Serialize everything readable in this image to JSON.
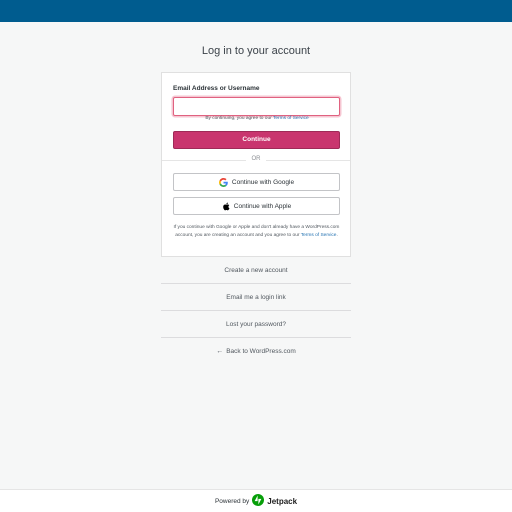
{
  "header": {
    "bar_color": "#005c8f"
  },
  "page": {
    "title": "Log in to your account"
  },
  "login": {
    "email_label": "Email Address or Username",
    "email_value": "",
    "terms_prefix": "By continuing, you agree to our",
    "terms_link": "Terms of Service",
    "continue_label": "Continue",
    "continue_color": "#c9356e",
    "or_label": "OR",
    "google_label": "Continue with Google",
    "google_icon": "google-icon",
    "apple_label": "Continue with Apple",
    "apple_icon": "apple-icon",
    "disclaimer_text": "If you continue with Google or Apple and don't already have a WordPress.com account, you are creating an account and you agree to our",
    "disclaimer_link": "Terms of Service",
    "disclaimer_end": "."
  },
  "links": {
    "create_account": "Create a new account",
    "email_login_link": "Email me a login link",
    "lost_password": "Lost your password?",
    "back_to_wp": "Back to WordPress.com",
    "back_icon": "arrow-left-icon"
  },
  "footer": {
    "powered_by": "Powered by",
    "brand": "Jetpack",
    "brand_icon": "jetpack-logo-icon",
    "brand_color": "#069e08"
  }
}
